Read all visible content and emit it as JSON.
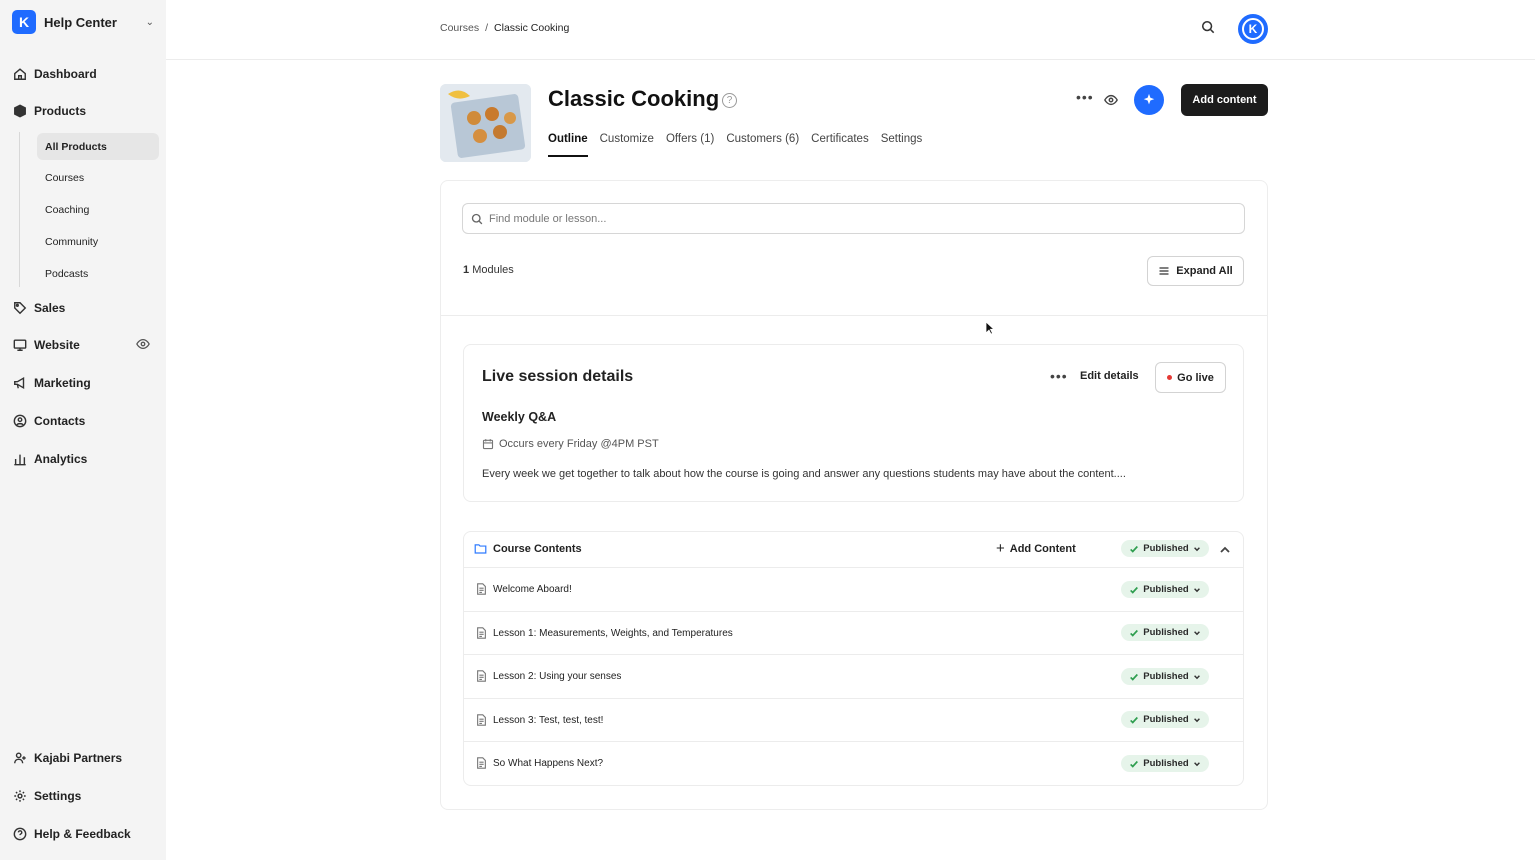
{
  "sidebar": {
    "brand": "Help Center",
    "brand_letter": "K",
    "nav": [
      {
        "label": "Dashboard",
        "icon": "home-icon"
      },
      {
        "label": "Products",
        "icon": "box-icon"
      },
      {
        "label": "Sales",
        "icon": "tag-icon"
      },
      {
        "label": "Website",
        "icon": "monitor-icon"
      },
      {
        "label": "Marketing",
        "icon": "megaphone-icon"
      },
      {
        "label": "Contacts",
        "icon": "contact-icon"
      },
      {
        "label": "Analytics",
        "icon": "bar-chart-icon"
      }
    ],
    "products_sub": [
      "All Products",
      "Courses",
      "Coaching",
      "Community",
      "Podcasts"
    ],
    "bottom": [
      {
        "label": "Kajabi Partners",
        "icon": "user-plus-icon"
      },
      {
        "label": "Settings",
        "icon": "gear-icon"
      },
      {
        "label": "Help & Feedback",
        "icon": "help-circle-icon"
      }
    ]
  },
  "topbar": {
    "breadcrumb": [
      "Courses",
      "/",
      "Classic Cooking"
    ],
    "avatar_letter": "K"
  },
  "header": {
    "title": "Classic Cooking",
    "add_content_label": "Add content",
    "tabs": [
      "Outline",
      "Customize",
      "Offers (1)",
      "Customers (6)",
      "Certificates",
      "Settings"
    ],
    "active_tab": "Outline"
  },
  "outline": {
    "search_placeholder": "Find module or lesson...",
    "modules_count": "1",
    "modules_label": "Modules",
    "expand_all_label": "Expand All"
  },
  "live_session": {
    "title": "Live session details",
    "edit_label": "Edit details",
    "go_live_label": "Go live",
    "name": "Weekly Q&A",
    "schedule": "Occurs every Friday @4PM PST",
    "description": "Every week we get together to talk about how the course is going and answer any questions students may have about the content...."
  },
  "contents": {
    "title": "Course Contents",
    "add_label": "Add Content",
    "status": "Published",
    "lessons": [
      {
        "title": "Welcome Aboard!",
        "status": "Published"
      },
      {
        "title": "Lesson 1: Measurements, Weights, and Temperatures",
        "status": "Published"
      },
      {
        "title": "Lesson 2: Using your senses",
        "status": "Published"
      },
      {
        "title": "Lesson 3: Test, test, test!",
        "status": "Published"
      },
      {
        "title": "So What Happens Next?",
        "status": "Published"
      }
    ]
  },
  "colors": {
    "accent": "#1f6bff",
    "published_bg": "#e6f4ea",
    "published_check": "#2e9e4f",
    "go_live_dot": "#e53935"
  }
}
